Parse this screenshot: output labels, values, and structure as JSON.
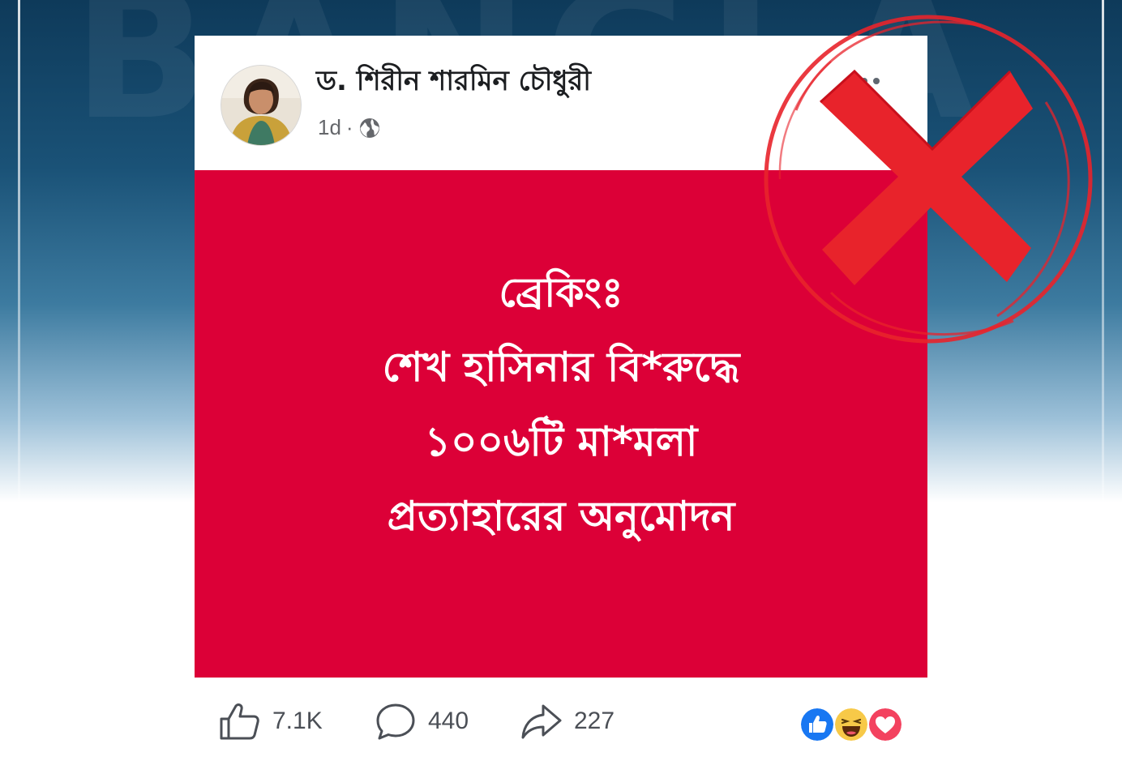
{
  "background": {
    "watermark_text": "BANGLA"
  },
  "post": {
    "author": "ড. শিরীন শারমিন চৌধুরী",
    "time": "1d",
    "separator": "·",
    "privacy_icon": "globe-icon",
    "more_icon": "more-options-icon",
    "image": {
      "background_color": "#dc0037",
      "headline_lines": [
        "ব্রেকিংঃ",
        "শেখ হাসিনার বি*রুদ্ধে",
        "১০০৬টি মা*মলা",
        "প্রত্যাহারের অনুমোদন"
      ]
    }
  },
  "footer": {
    "likes": "7.1K",
    "comments": "440",
    "shares": "227",
    "like_icon": "thumbs-up-icon",
    "comment_icon": "comment-icon",
    "share_icon": "share-icon",
    "reactions": [
      "like-reaction-icon",
      "haha-reaction-icon",
      "love-reaction-icon"
    ]
  },
  "overlay": {
    "stamp_icon": "fake-cross-stamp-icon",
    "stamp_color": "#e8232b"
  }
}
